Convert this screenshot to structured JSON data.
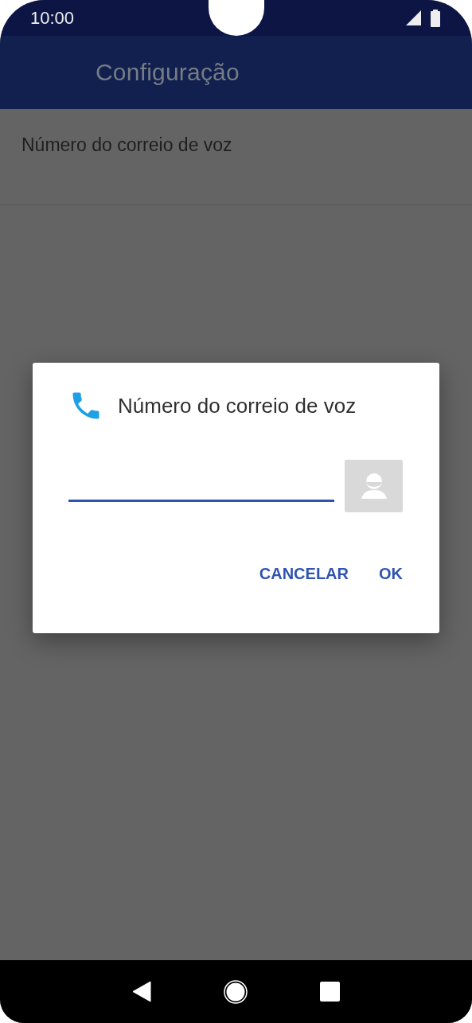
{
  "status_bar": {
    "time": "10:00"
  },
  "app_bar": {
    "title": "Configuração"
  },
  "list": [
    {
      "label": "Número do correio de voz"
    }
  ],
  "dialog": {
    "title": "Número do correio de voz",
    "buttons": [
      {
        "label": "CANCELAR"
      },
      {
        "label": "OK"
      }
    ]
  }
}
